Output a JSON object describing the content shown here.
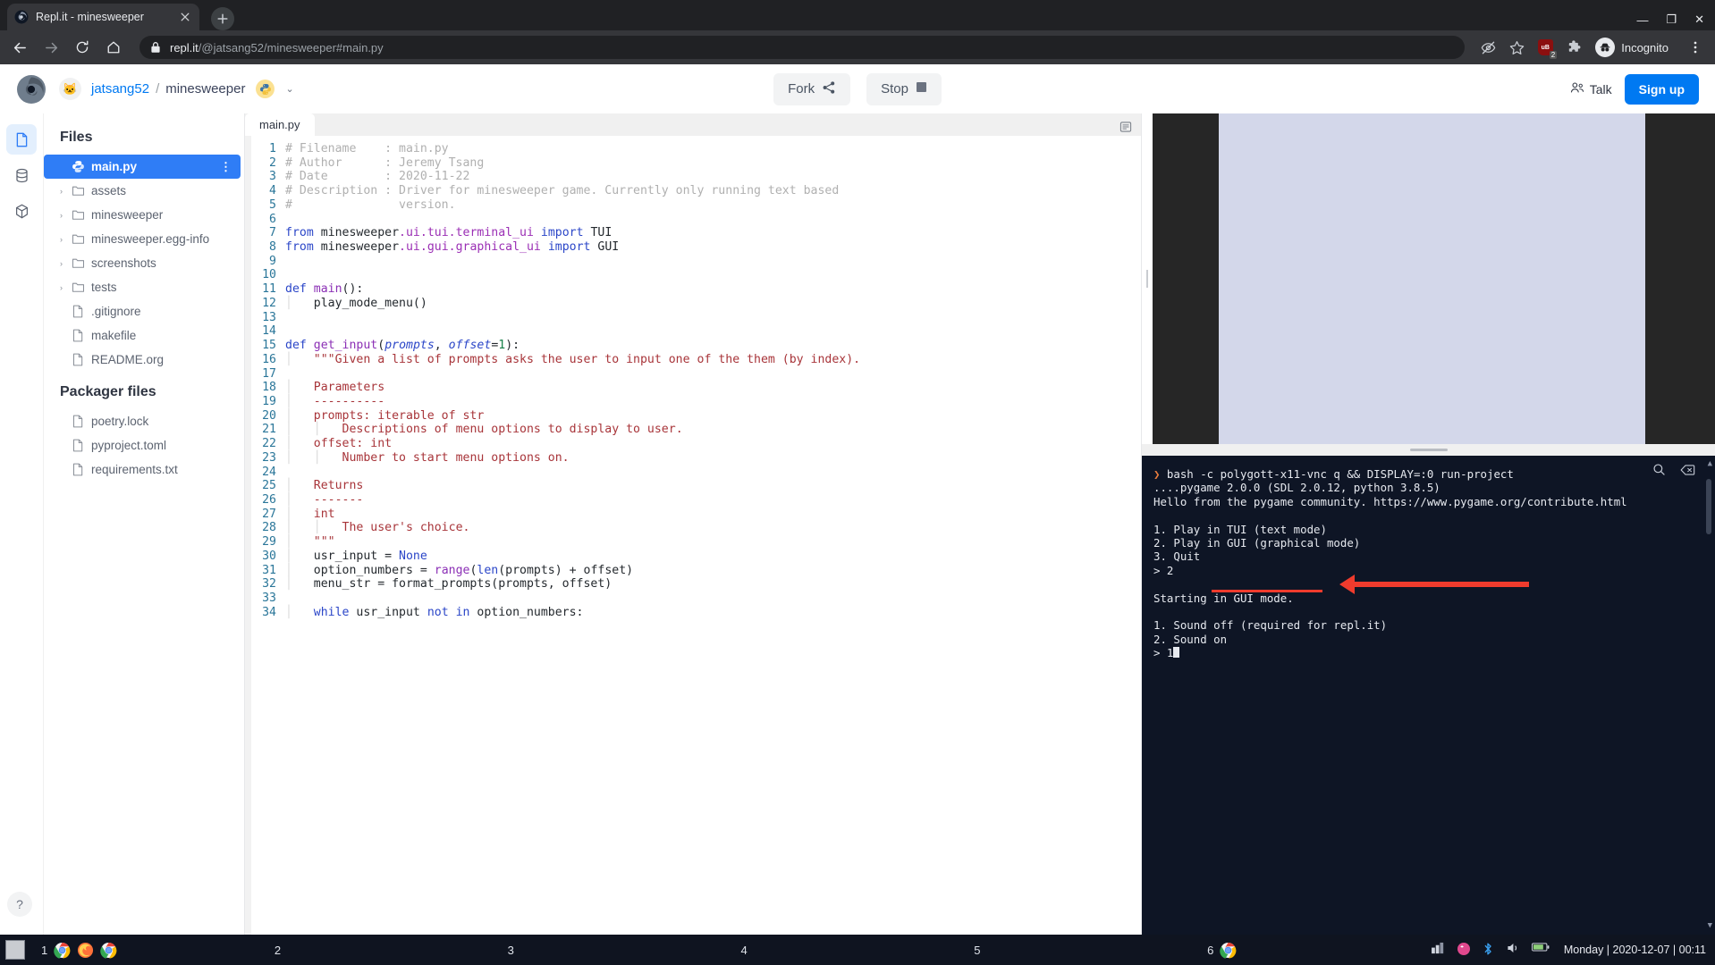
{
  "browser": {
    "tab": {
      "title": "Repl.it - minesweeper",
      "favicon": "replit-favicon",
      "close": "×"
    },
    "new_tab_label": "+",
    "nav": {
      "back": "←",
      "forward": "→",
      "reload": "⟳",
      "home": "⌂"
    },
    "omnibox": {
      "lock_icon": "lock-icon",
      "url_host": "repl.it",
      "url_path": "/@jatsang52/minesweeper#main.py"
    },
    "toolbar_icons": [
      {
        "name": "tracking-protection-icon",
        "glyph": "⦸"
      },
      {
        "name": "bookmark-star-icon",
        "glyph": "☆"
      },
      {
        "name": "ublock-origin-icon",
        "glyph": "uB",
        "badge": "2"
      },
      {
        "name": "extensions-puzzle-icon",
        "glyph": "🧩"
      }
    ],
    "incognito_label": "Incognito",
    "menu_icon": "⋮",
    "window_controls": {
      "minimize": "—",
      "maximize": "❐",
      "close": "✕"
    }
  },
  "replit": {
    "header": {
      "logo": "replit-logo",
      "avatar": "owner-avatar",
      "user": "jatsang52",
      "separator": "/",
      "repl_name": "minesweeper",
      "language_icon": "python-icon",
      "chevron": "⌄",
      "fork_label": "Fork",
      "fork_icon": "share-nodes-icon",
      "stop_label": "Stop",
      "stop_icon": "stop-square-icon",
      "talk_label": "Talk",
      "talk_icon": "people-icon",
      "signup_label": "Sign up"
    },
    "iconbar": [
      {
        "name": "files-icon",
        "active": true
      },
      {
        "name": "database-icon",
        "active": false
      },
      {
        "name": "packages-icon",
        "active": false
      }
    ],
    "help_icon": "?",
    "files_title": "Files",
    "files": [
      {
        "label": "main.py",
        "type": "file",
        "icon": "python-file-icon",
        "selected": true,
        "kebab": "⋮"
      },
      {
        "label": "assets",
        "type": "folder",
        "expandable": true
      },
      {
        "label": "minesweeper",
        "type": "folder",
        "expandable": true
      },
      {
        "label": "minesweeper.egg-info",
        "type": "folder",
        "expandable": true
      },
      {
        "label": "screenshots",
        "type": "folder",
        "expandable": true
      },
      {
        "label": "tests",
        "type": "folder",
        "expandable": true
      },
      {
        "label": ".gitignore",
        "type": "file"
      },
      {
        "label": "makefile",
        "type": "file"
      },
      {
        "label": "README.org",
        "type": "file"
      }
    ],
    "packager_title": "Packager files",
    "packager_files": [
      {
        "label": "poetry.lock",
        "type": "file"
      },
      {
        "label": "pyproject.toml",
        "type": "file"
      },
      {
        "label": "requirements.txt",
        "type": "file"
      }
    ],
    "editor": {
      "tab_label": "main.py",
      "settings_icon": "editor-settings-icon",
      "first_line": 1,
      "last_line": 34
    }
  },
  "code": {
    "lines": [
      "<span class=\"c-com\"># Filename    : main.py</span>",
      "<span class=\"c-com\"># Author      : Jeremy Tsang</span>",
      "<span class=\"c-com\"># Date        : 2020-11-22</span>",
      "<span class=\"c-com\"># Description : Driver for minesweeper game. Currently only running text based</span>",
      "<span class=\"c-com\">#               version.</span>",
      "",
      "<span class=\"c-kw\">from</span> minesweeper<span class=\"c-mod\">.ui</span><span class=\"c-mod\">.tui</span><span class=\"c-mod\">.terminal_ui</span> <span class=\"c-kw\">import</span> TUI",
      "<span class=\"c-kw\">from</span> minesweeper<span class=\"c-mod\">.ui</span><span class=\"c-mod\">.gui</span><span class=\"c-mod\">.graphical_ui</span> <span class=\"c-kw\">import</span> GUI",
      "",
      "",
      "<span class=\"c-kw\">def</span> <span class=\"c-fn\">main</span>():",
      "<span class=\"indent\">│   </span>play_mode_menu()",
      "",
      "",
      "<span class=\"c-kw\">def</span> <span class=\"c-fn\">get_input</span>(<span class=\"c-param\">prompts</span>, <span class=\"c-param\">offset</span>=<span class=\"c-num\">1</span>):",
      "<span class=\"indent\">│   </span><span class=\"c-str\">\"\"\"Given a list of prompts asks the user to input one of the them (by index).</span>",
      "",
      "<span class=\"indent\">│   </span><span class=\"c-str\">Parameters</span>",
      "<span class=\"indent\">│   </span><span class=\"c-str\">----------</span>",
      "<span class=\"indent\">│   </span><span class=\"c-str\">prompts: iterable of str</span>",
      "<span class=\"indent\">│   │   </span><span class=\"c-str\">Descriptions of menu options to display to user.</span>",
      "<span class=\"indent\">│   </span><span class=\"c-str\">offset: int</span>",
      "<span class=\"indent\">│   │   </span><span class=\"c-str\">Number to start menu options on.</span>",
      "",
      "<span class=\"indent\">│   </span><span class=\"c-str\">Returns</span>",
      "<span class=\"indent\">│   </span><span class=\"c-str\">-------</span>",
      "<span class=\"indent\">│   </span><span class=\"c-str\">int</span>",
      "<span class=\"indent\">│   │   </span><span class=\"c-str\">The user's choice.</span>",
      "<span class=\"indent\">│   </span><span class=\"c-str\">\"\"\"</span>",
      "<span class=\"indent\">│   </span>usr_input = <span class=\"c-none\">None</span>",
      "<span class=\"indent\">│   </span>option_numbers = <span class=\"c-fn\">range</span>(<span class=\"c-builtin\">len</span>(prompts) + offset)",
      "<span class=\"indent\">│   </span>menu_str = format_prompts(prompts, offset)",
      "",
      "<span class=\"indent\">│   </span><span class=\"c-kw\">while</span> usr_input <span class=\"c-kw\">not in</span> option_numbers:"
    ]
  },
  "console": {
    "search_icon": "search-icon",
    "clear_icon": "clear-console-icon",
    "lines": [
      {
        "text": "bash -c polygott-x11-vnc q && DISPLAY=:0 run-project",
        "prompt": true
      },
      {
        "text": "....pygame 2.0.0 (SDL 2.0.12, python 3.8.5)"
      },
      {
        "text": "Hello from the pygame community. https://www.pygame.org/contribute.html"
      },
      {
        "text": ""
      },
      {
        "text": "1. Play in TUI (text mode)"
      },
      {
        "text": "2. Play in GUI (graphical mode)"
      },
      {
        "text": "3. Quit"
      },
      {
        "text": "> 2"
      },
      {
        "text": ""
      },
      {
        "text": "Starting in GUI mode."
      },
      {
        "text": ""
      },
      {
        "text": "1. Sound off (required for repl.it)"
      },
      {
        "text": "2. Sound on"
      },
      {
        "text": "> 1",
        "cursor": true
      }
    ],
    "annotation": {
      "underline_target": "1. Sound off (required for repl.it)",
      "color": "#ef3b2d",
      "shape": "arrow-pointing-left"
    }
  },
  "taskbar": {
    "show_desktop_icon": "show-desktop-icon",
    "workspaces": [
      {
        "num": "1",
        "apps": [
          "chrome-icon",
          "firefox-icon",
          "chrome-icon"
        ]
      },
      {
        "num": "2",
        "apps": []
      },
      {
        "num": "3",
        "apps": []
      },
      {
        "num": "4",
        "apps": []
      },
      {
        "num": "5",
        "apps": []
      },
      {
        "num": "6",
        "apps": [
          "chrome-icon"
        ]
      }
    ],
    "tray_icons": [
      "network-icon",
      "dropbox-icon",
      "bluetooth-icon",
      "volume-icon",
      "battery-icon"
    ],
    "clock": "Monday | 2020-12-07 | 00:11"
  }
}
